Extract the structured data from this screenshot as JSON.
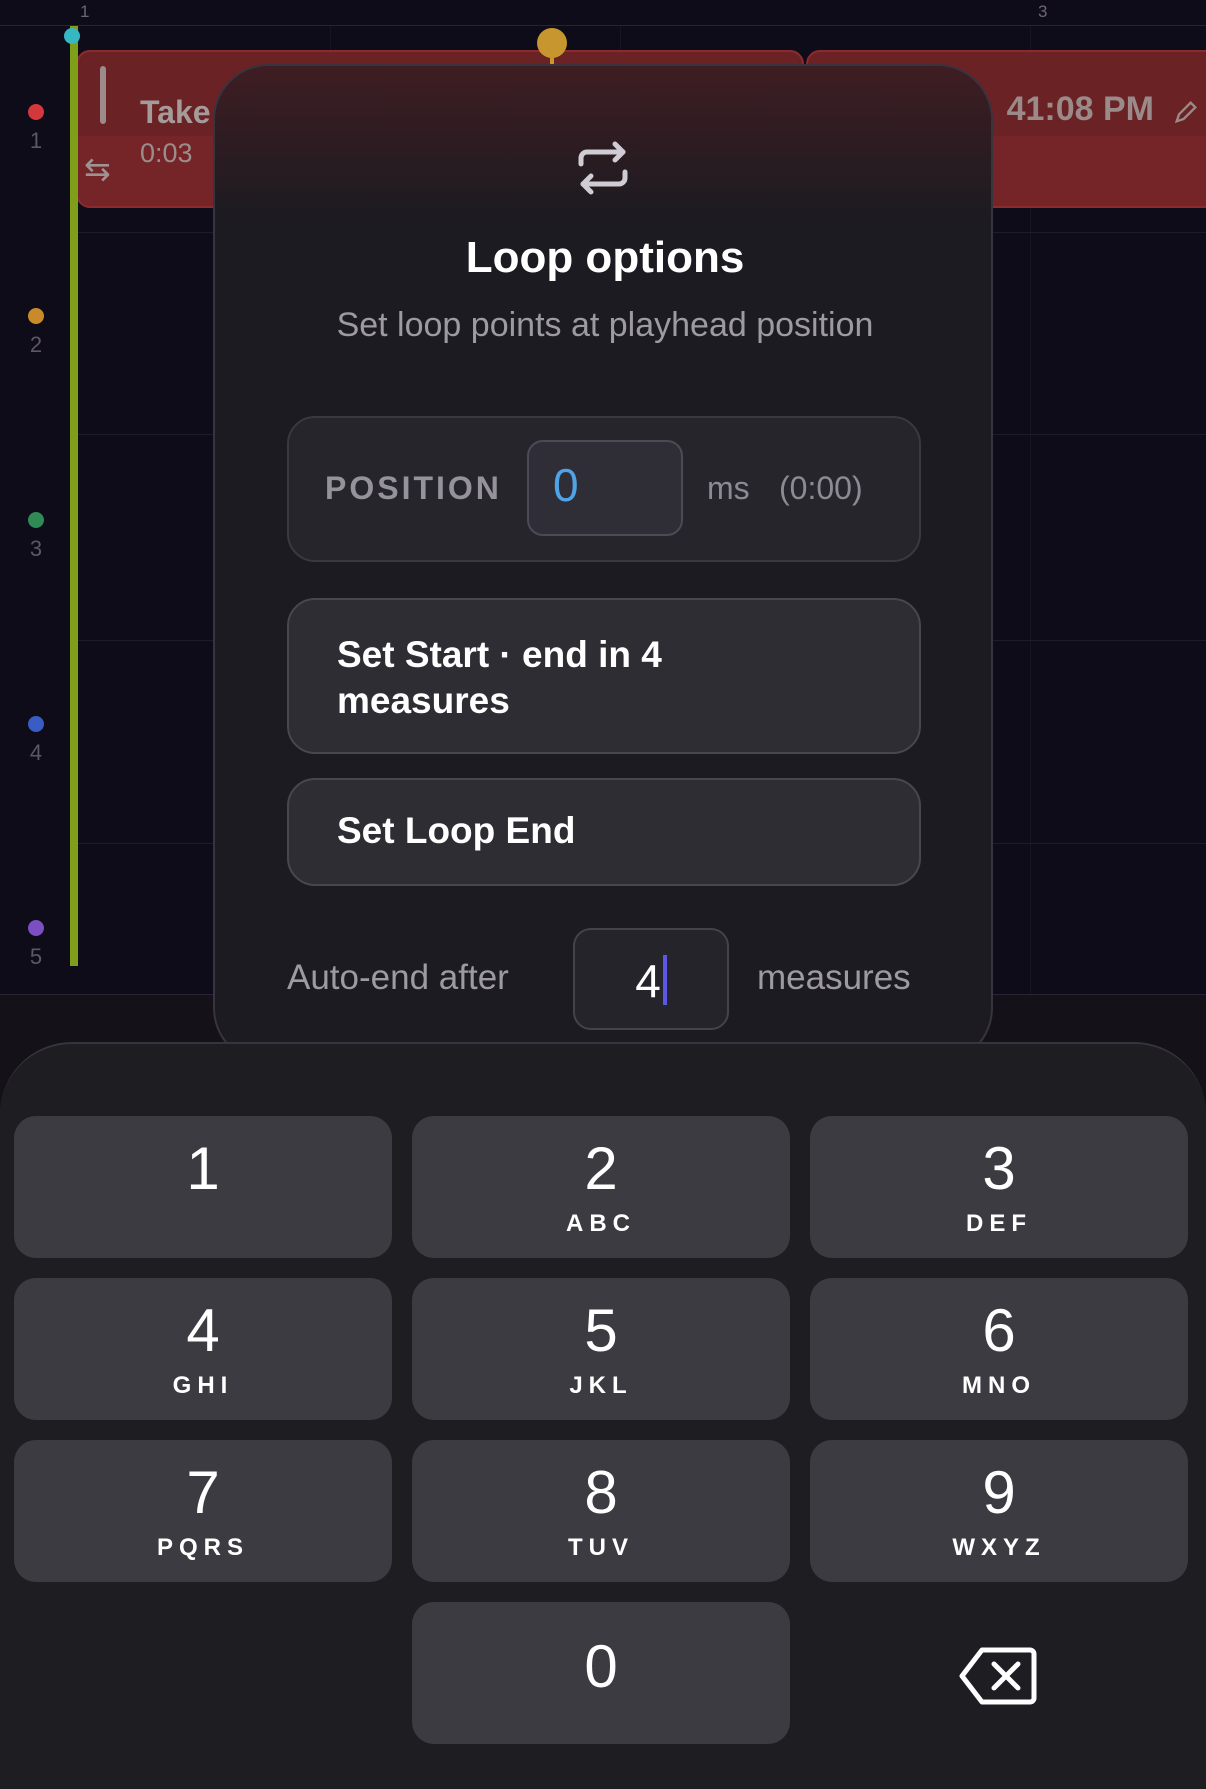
{
  "timeline": {
    "ruler": [
      "1",
      "3"
    ],
    "tracks": [
      {
        "number": "1",
        "color": "#d4383c"
      },
      {
        "number": "2",
        "color": "#c98a2a"
      },
      {
        "number": "3",
        "color": "#2f8a55"
      },
      {
        "number": "4",
        "color": "#3a5cc5"
      },
      {
        "number": "5",
        "color": "#7b4ec2"
      }
    ],
    "clip_a": {
      "title": "Take",
      "duration": "0:03"
    },
    "clip_b": {
      "time": "41:08 PM"
    }
  },
  "modal": {
    "title": "Loop options",
    "subtitle": "Set loop points at playhead position",
    "position_label": "POSITION",
    "position_value": "0",
    "position_unit": "ms",
    "position_hint": "(0:00)",
    "set_start_label": "Set Start · end in 4 measures",
    "set_end_label": "Set Loop End",
    "auto_end_label": "Auto-end after",
    "auto_end_value": "4",
    "auto_end_unit": "measures",
    "icon": "loop-icon"
  },
  "keypad": {
    "keys": [
      {
        "digit": "1",
        "letters": ""
      },
      {
        "digit": "2",
        "letters": "ABC"
      },
      {
        "digit": "3",
        "letters": "DEF"
      },
      {
        "digit": "4",
        "letters": "GHI"
      },
      {
        "digit": "5",
        "letters": "JKL"
      },
      {
        "digit": "6",
        "letters": "MNO"
      },
      {
        "digit": "7",
        "letters": "PQRS"
      },
      {
        "digit": "8",
        "letters": "TUV"
      },
      {
        "digit": "9",
        "letters": "WXYZ"
      },
      {
        "digit": "0",
        "letters": ""
      }
    ],
    "backspace_icon": "backspace-icon"
  }
}
